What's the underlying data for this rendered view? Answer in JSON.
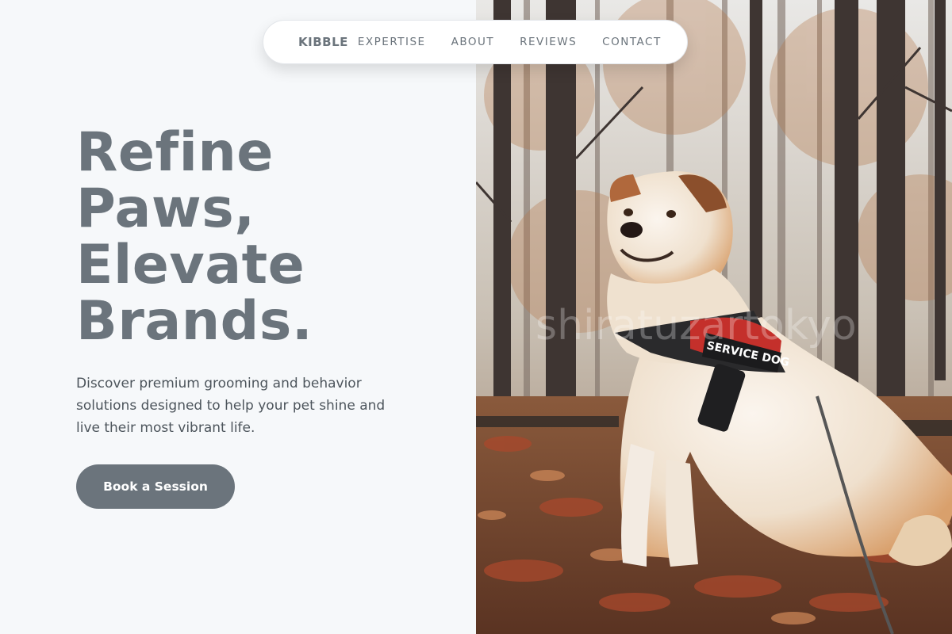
{
  "nav": {
    "brand": "KIBBLE",
    "links": [
      "EXPERTISE",
      "ABOUT",
      "REVIEWS",
      "CONTACT"
    ]
  },
  "hero": {
    "title_lines": [
      "Refine",
      "Paws,",
      "Elevate",
      "Brands."
    ],
    "description": "Discover premium grooming and behavior solutions designed to help your pet shine and live their most vibrant life.",
    "cta_label": "Book a Session"
  },
  "photo": {
    "harness_text": "SERVICE DOG",
    "watermark": "shiratuzartokyo"
  },
  "colors": {
    "accent": "#6b747c",
    "background": "#f6f8fa",
    "body_text": "#4d555c"
  }
}
